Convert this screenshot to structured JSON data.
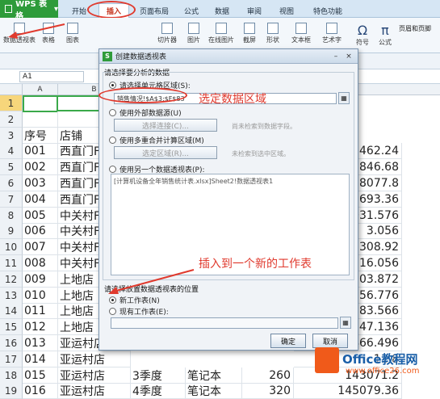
{
  "app": {
    "name": "WPS 表格"
  },
  "tabs": [
    "开始",
    "插入",
    "页面布局",
    "公式",
    "数据",
    "审阅",
    "视图",
    "特色功能"
  ],
  "ribbon": {
    "items": [
      "数据透视表",
      "表格",
      "图表",
      "切片器",
      "图片",
      "在线图片",
      "截屏",
      "形状",
      "文本框",
      "艺术字",
      "符号",
      "公式",
      "页眉和页脚"
    ]
  },
  "namebox": "A1",
  "columns": [
    "A",
    "B"
  ],
  "rows": [
    {
      "n": "1",
      "a": "",
      "b": "",
      "d": ""
    },
    {
      "n": "2",
      "a": "",
      "b": "",
      "d": ""
    },
    {
      "n": "3",
      "a": "序号",
      "b": "店铺",
      "d": ""
    },
    {
      "n": "4",
      "a": "001",
      "b": "西直门F",
      "d": "462.24"
    },
    {
      "n": "5",
      "a": "002",
      "b": "西直门F",
      "d": "846.68"
    },
    {
      "n": "6",
      "a": "003",
      "b": "西直门F",
      "d": "8077.8"
    },
    {
      "n": "7",
      "a": "004",
      "b": "西直门F",
      "d": "693.36"
    },
    {
      "n": "8",
      "a": "005",
      "b": "中关村F",
      "d": "031.576"
    },
    {
      "n": "9",
      "a": "006",
      "b": "中关村F",
      "d": "3.056"
    },
    {
      "n": "10",
      "a": "007",
      "b": "中关村F",
      "d": "308.92"
    },
    {
      "n": "11",
      "a": "008",
      "b": "中关村F",
      "d": "116.056"
    },
    {
      "n": "12",
      "a": "009",
      "b": "上地店",
      "d": "03.872"
    },
    {
      "n": "13",
      "a": "010",
      "b": "上地店",
      "d": "56.776"
    },
    {
      "n": "14",
      "a": "011",
      "b": "上地店",
      "d": "83.566"
    },
    {
      "n": "15",
      "a": "012",
      "b": "上地店",
      "d": "547.136"
    },
    {
      "n": "16",
      "a": "013",
      "b": "亚运村店",
      "d": "466.496"
    },
    {
      "n": "17",
      "a": "014",
      "b": "亚运村店",
      "d": "11.8"
    },
    {
      "n": "18",
      "a": "015",
      "b": "亚运村店",
      "c": "3季度",
      "e": "笔记本",
      "f": "260",
      "d": "143071.2"
    },
    {
      "n": "19",
      "a": "016",
      "b": "亚运村店",
      "c": "4季度",
      "e": "笔记本",
      "f": "320",
      "d": "145079.36"
    }
  ],
  "dialog": {
    "title": "创建数据透视表",
    "section1": "请选择要分析的数据",
    "opt_range": "请选择单元格区域(S):",
    "range_value": "销售情况!$A$3:$F$83",
    "opt_external": "使用外部数据源(U)",
    "btn_choose_conn": "选择连接(C)...",
    "hint_no_field": "尚未检索到数据字段。",
    "opt_multi": "使用多重合并计算区域(M)",
    "btn_choose_area": "选定区域(R)...",
    "hint_no_area": "未检索到选中区域。",
    "opt_other": "使用另一个数据透视表(P):",
    "other_value": "[计算机设备全年销售统计表.xlsx]Sheet2!数据透视表1",
    "section2": "请选择放置数据透视表的位置",
    "opt_new": "新工作表(N)",
    "opt_existing": "现有工作表(E):",
    "ok": "确定",
    "cancel": "取消"
  },
  "annotations": {
    "select_range": "选定数据区域",
    "insert_new": "插入到一个新的工作表"
  },
  "watermark": {
    "brand": "Office教程网",
    "url": "www.office26.com"
  },
  "colors": {
    "annotation": "#e03a2e",
    "accent_green": "#2e9b3a",
    "brand_orange": "#f05a1a"
  }
}
